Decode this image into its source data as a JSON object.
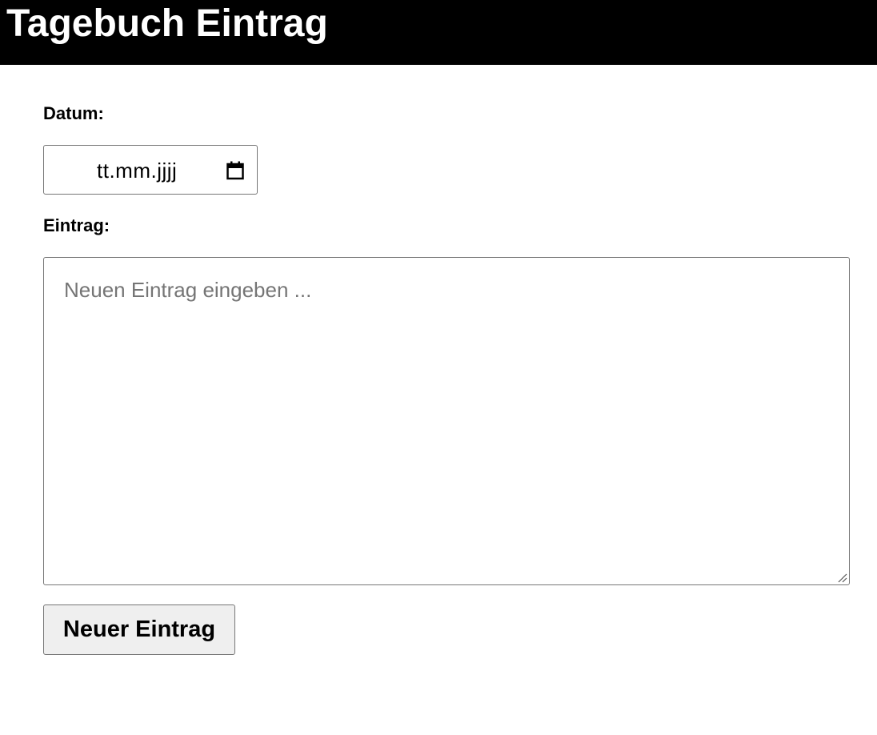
{
  "header": {
    "title": "Tagebuch Eintrag"
  },
  "form": {
    "date_label": "Datum:",
    "date_placeholder": "tt.mm.jjjj",
    "entry_label": "Eintrag:",
    "entry_placeholder": "Neuen Eintrag eingeben ...",
    "submit_label": "Neuer Eintrag"
  },
  "icons": {
    "date_picker": "calendar-icon",
    "resize": "resize-handle-icon"
  },
  "colors": {
    "header_background": "#000000",
    "header_text": "#ffffff",
    "button_background": "#efefef",
    "border": "#767676",
    "placeholder_text": "#757575"
  }
}
